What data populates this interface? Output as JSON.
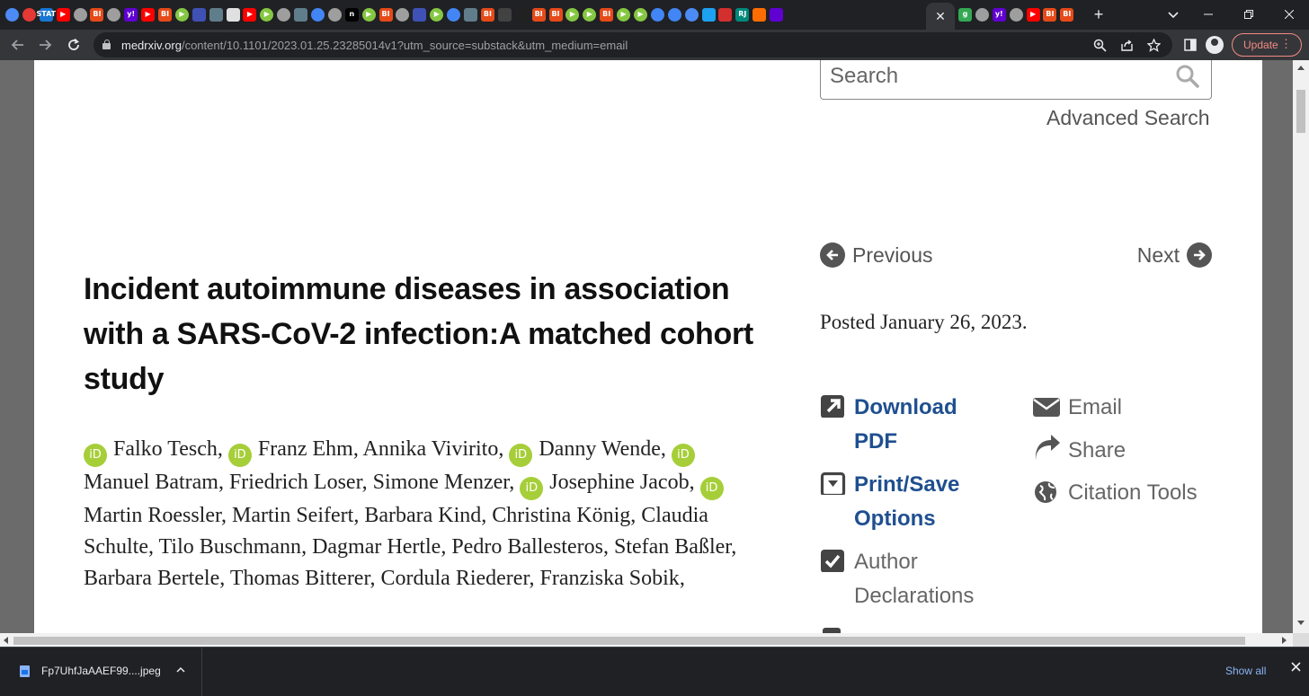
{
  "browser": {
    "tabs_favicons": [
      {
        "icon": "web-globe-icon",
        "color": "#4c8bf5",
        "round": true,
        "text": ""
      },
      {
        "icon": "chrome-red-icon",
        "color": "#e53935",
        "round": true,
        "text": ""
      },
      {
        "icon": "stat-icon",
        "color": "#1976d2",
        "round": false,
        "text": "STAT"
      },
      {
        "icon": "youtube-icon",
        "color": "#ff0000",
        "round": false,
        "text": "▶"
      },
      {
        "icon": "globe-icon",
        "color": "#9e9e9e",
        "round": true,
        "text": ""
      },
      {
        "icon": "bi-icon",
        "color": "#e64a19",
        "round": false,
        "text": "BI"
      },
      {
        "icon": "globe-icon",
        "color": "#9e9e9e",
        "round": true,
        "text": ""
      },
      {
        "icon": "yahoo-icon",
        "color": "#6001d2",
        "round": false,
        "text": "y!"
      },
      {
        "icon": "youtube-icon",
        "color": "#ff0000",
        "round": false,
        "text": "▶"
      },
      {
        "icon": "bi-icon",
        "color": "#e64a19",
        "round": false,
        "text": "BI"
      },
      {
        "icon": "rumble-icon",
        "color": "#85c742",
        "round": true,
        "text": "▶"
      },
      {
        "icon": "shield-icon",
        "color": "#3f51b5",
        "round": false,
        "text": ""
      },
      {
        "icon": "bookmark-icon",
        "color": "#607d8b",
        "round": false,
        "text": ""
      },
      {
        "icon": "puzzle-icon",
        "color": "#e0e0e0",
        "round": false,
        "text": ""
      },
      {
        "icon": "youtube-icon",
        "color": "#ff0000",
        "round": false,
        "text": "▶"
      },
      {
        "icon": "rumble-icon",
        "color": "#85c742",
        "round": true,
        "text": "▶"
      },
      {
        "icon": "globe-icon",
        "color": "#9e9e9e",
        "round": true,
        "text": ""
      },
      {
        "icon": "bookmark-icon",
        "color": "#607d8b",
        "round": false,
        "text": ""
      },
      {
        "icon": "search-small-icon",
        "color": "#4285f4",
        "round": true,
        "text": ""
      },
      {
        "icon": "globe-icon",
        "color": "#9e9e9e",
        "round": true,
        "text": ""
      },
      {
        "icon": "n-icon",
        "color": "#000000",
        "round": false,
        "text": "n"
      },
      {
        "icon": "rumble-icon",
        "color": "#85c742",
        "round": true,
        "text": "▶"
      },
      {
        "icon": "bi-icon",
        "color": "#e64a19",
        "round": false,
        "text": "BI"
      },
      {
        "icon": "globe-icon",
        "color": "#9e9e9e",
        "round": true,
        "text": ""
      },
      {
        "icon": "shield-icon",
        "color": "#3f51b5",
        "round": false,
        "text": ""
      },
      {
        "icon": "rumble-icon",
        "color": "#85c742",
        "round": true,
        "text": "▶"
      },
      {
        "icon": "search-small-icon",
        "color": "#4285f4",
        "round": true,
        "text": ""
      },
      {
        "icon": "bookmark-icon",
        "color": "#607d8b",
        "round": false,
        "text": ""
      },
      {
        "icon": "bi-icon",
        "color": "#e64a19",
        "round": false,
        "text": "BI"
      },
      {
        "icon": "dark-icon",
        "color": "#424242",
        "round": false,
        "text": ""
      },
      {
        "icon": "dark-icon",
        "color": "#212121",
        "round": false,
        "text": ""
      },
      {
        "icon": "bi-icon",
        "color": "#e64a19",
        "round": false,
        "text": "BI"
      },
      {
        "icon": "bi-icon",
        "color": "#e64a19",
        "round": false,
        "text": "BI"
      },
      {
        "icon": "rumble-icon",
        "color": "#85c742",
        "round": true,
        "text": "▶"
      },
      {
        "icon": "rumble-icon",
        "color": "#85c742",
        "round": true,
        "text": "▶"
      },
      {
        "icon": "bi-icon",
        "color": "#e64a19",
        "round": false,
        "text": "BI"
      },
      {
        "icon": "rumble-icon",
        "color": "#85c742",
        "round": true,
        "text": "▶"
      },
      {
        "icon": "rumble-icon",
        "color": "#85c742",
        "round": true,
        "text": "▶"
      },
      {
        "icon": "search-small-icon",
        "color": "#4285f4",
        "round": true,
        "text": ""
      },
      {
        "icon": "search-small-icon",
        "color": "#4285f4",
        "round": true,
        "text": ""
      },
      {
        "icon": "web-globe-icon",
        "color": "#4c8bf5",
        "round": true,
        "text": ""
      },
      {
        "icon": "twitter-icon",
        "color": "#1da1f2",
        "round": false,
        "text": ""
      },
      {
        "icon": "red-arrow-icon",
        "color": "#d32f2f",
        "round": false,
        "text": ""
      },
      {
        "icon": "rj-icon",
        "color": "#00897b",
        "round": false,
        "text": "RJ"
      },
      {
        "icon": "stack-icon",
        "color": "#ff6d00",
        "round": false,
        "text": ""
      },
      {
        "icon": "yahoo-mail-icon",
        "color": "#6001d2",
        "round": false,
        "text": ""
      }
    ],
    "active_tab_close": "✕",
    "after_tabs_favicons": [
      {
        "icon": "g-icon",
        "color": "#34a853",
        "round": false,
        "text": "g"
      },
      {
        "icon": "globe-icon",
        "color": "#9e9e9e",
        "round": true,
        "text": ""
      },
      {
        "icon": "yahoo-icon",
        "color": "#6001d2",
        "round": false,
        "text": "y!"
      },
      {
        "icon": "globe-icon",
        "color": "#9e9e9e",
        "round": true,
        "text": ""
      },
      {
        "icon": "youtube-icon",
        "color": "#ff0000",
        "round": false,
        "text": "▶"
      },
      {
        "icon": "bi-icon",
        "color": "#e64a19",
        "round": false,
        "text": "BI"
      },
      {
        "icon": "bi-icon",
        "color": "#e64a19",
        "round": false,
        "text": "BI"
      }
    ],
    "new_tab_label": "+",
    "url_host": "medrxiv.org",
    "url_path": "/content/10.1101/2023.01.25.23285014v1?utm_source=substack&utm_medium=email",
    "update_label": "Update"
  },
  "page": {
    "search_placeholder": "Search",
    "advanced_search": "Advanced Search",
    "previous": "Previous",
    "next": "Next",
    "posted": "Posted January 26, 2023.",
    "title": "Incident autoimmune diseases in association with a SARS-CoV-2 infection:A matched cohort study",
    "authors": [
      {
        "name": "Falko Tesch",
        "orcid": true
      },
      {
        "name": "Franz Ehm",
        "orcid": true
      },
      {
        "name": "Annika Vivirito",
        "orcid": false
      },
      {
        "name": "Danny Wende",
        "orcid": true
      },
      {
        "name": "Manuel Batram",
        "orcid": true
      },
      {
        "name": "Friedrich Loser",
        "orcid": false
      },
      {
        "name": "Simone Menzer",
        "orcid": false
      },
      {
        "name": "Josephine Jacob",
        "orcid": true
      },
      {
        "name": "Martin Roessler",
        "orcid": true
      },
      {
        "name": "Martin Seifert",
        "orcid": false
      },
      {
        "name": "Barbara Kind",
        "orcid": false
      },
      {
        "name": "Christina König",
        "orcid": false
      },
      {
        "name": "Claudia Schulte",
        "orcid": false
      },
      {
        "name": "Tilo Buschmann",
        "orcid": false
      },
      {
        "name": "Dagmar Hertle",
        "orcid": false
      },
      {
        "name": "Pedro Ballesteros",
        "orcid": false
      },
      {
        "name": "Stefan Baßler",
        "orcid": false
      },
      {
        "name": "Barbara Bertele",
        "orcid": false
      },
      {
        "name": "Thomas Bitterer",
        "orcid": false
      },
      {
        "name": "Cordula Riederer",
        "orcid": false
      },
      {
        "name": "Franziska Sobik",
        "orcid": false
      }
    ],
    "orcid_label": "iD",
    "actions": {
      "download_pdf_line1": "Download",
      "download_pdf_line2": "PDF",
      "print_save_line1": "Print/Save",
      "print_save_line2": "Options",
      "author_decl_line1": "Author",
      "author_decl_line2": "Declarations",
      "email": "Email",
      "share": "Share",
      "citation_tools": "Citation Tools"
    },
    "colors": {
      "link_blue": "#1f4f8f",
      "orcid_green": "#a6ce39"
    }
  },
  "downloads": {
    "file_name": "Fp7UhfJaAAEF99....jpeg",
    "show_all": "Show all"
  }
}
